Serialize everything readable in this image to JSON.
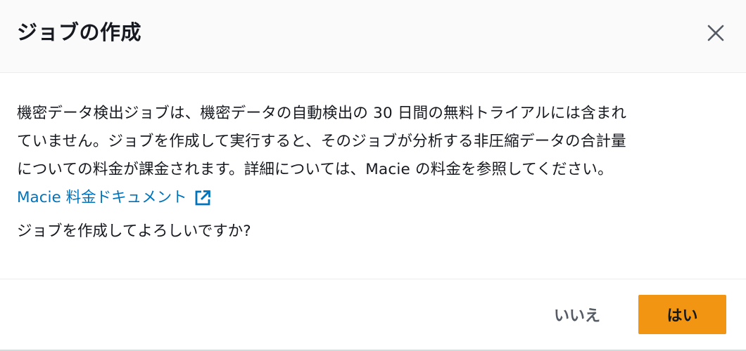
{
  "dialog": {
    "title": "ジョブの作成",
    "close_icon": "close-icon"
  },
  "body": {
    "lines": [
      "機密データ検出ジョブは、機密データの自動検出の 30 日間の無料トライアルには含まれ",
      "ていません。ジョブを作成して実行すると、そのジョブが分析する非圧縮データの合計量",
      "についての料金が課金されます。詳細については、Macie の料金を参照してください。"
    ],
    "link_label": "Macie 料金ドキュメント",
    "link_icon": "external-link-icon",
    "confirm_question": "ジョブを作成してよろしいですか?"
  },
  "footer": {
    "cancel_label": "いいえ",
    "confirm_label": "はい"
  },
  "colors": {
    "header_bg": "#fafafa",
    "link": "#0073bb",
    "primary_button": "#f29512",
    "text": "#16191f",
    "secondary_text": "#545b64"
  }
}
